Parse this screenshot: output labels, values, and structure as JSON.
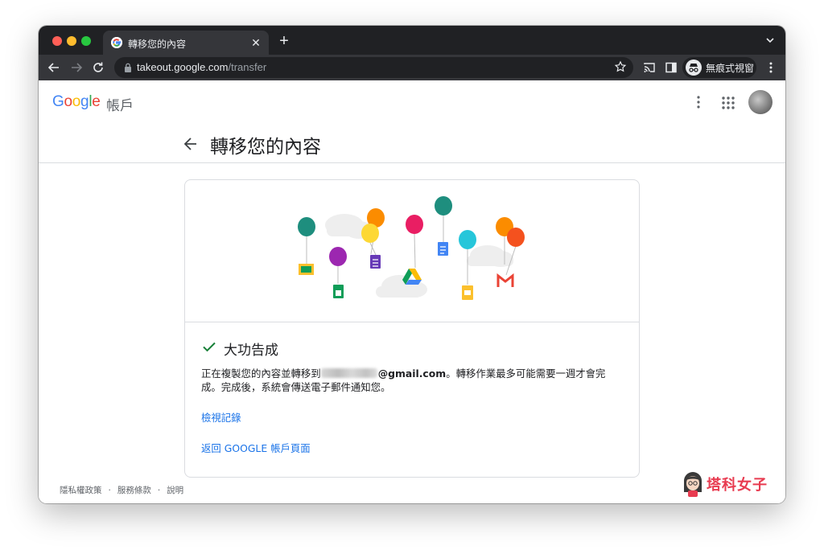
{
  "browser": {
    "tab_title": "轉移您的內容",
    "url_host": "takeout.google.com",
    "url_path": "/transfer",
    "incognito_label": "無痕式視窗"
  },
  "header": {
    "logo_letters": [
      "G",
      "o",
      "o",
      "g",
      "l",
      "e"
    ],
    "logo_colors": [
      "#4285f4",
      "#ea4335",
      "#fbbc05",
      "#4285f4",
      "#34a853",
      "#ea4335"
    ],
    "account_label": "帳戶"
  },
  "page": {
    "title": "轉移您的內容"
  },
  "card": {
    "done_title": "大功告成",
    "message_prefix": "正在複製您的內容並轉移到",
    "email_suffix": "@gmail.com",
    "message_suffix": "。轉移作業最多可能需要一週才會完成。完成後，系統會傳送電子郵件通知您。",
    "link_history": "檢視記錄",
    "link_return": "返回 GOOGLE 帳戶頁面"
  },
  "footer": {
    "items": [
      "隱私權政策",
      "服務條款",
      "說明"
    ],
    "separator": "·"
  },
  "watermark": {
    "text": "塔科女子"
  },
  "colors": {
    "link": "#1a73e8",
    "check": "#188038",
    "chrome_dark": "#202124",
    "chrome_toolbar": "#35363a"
  }
}
